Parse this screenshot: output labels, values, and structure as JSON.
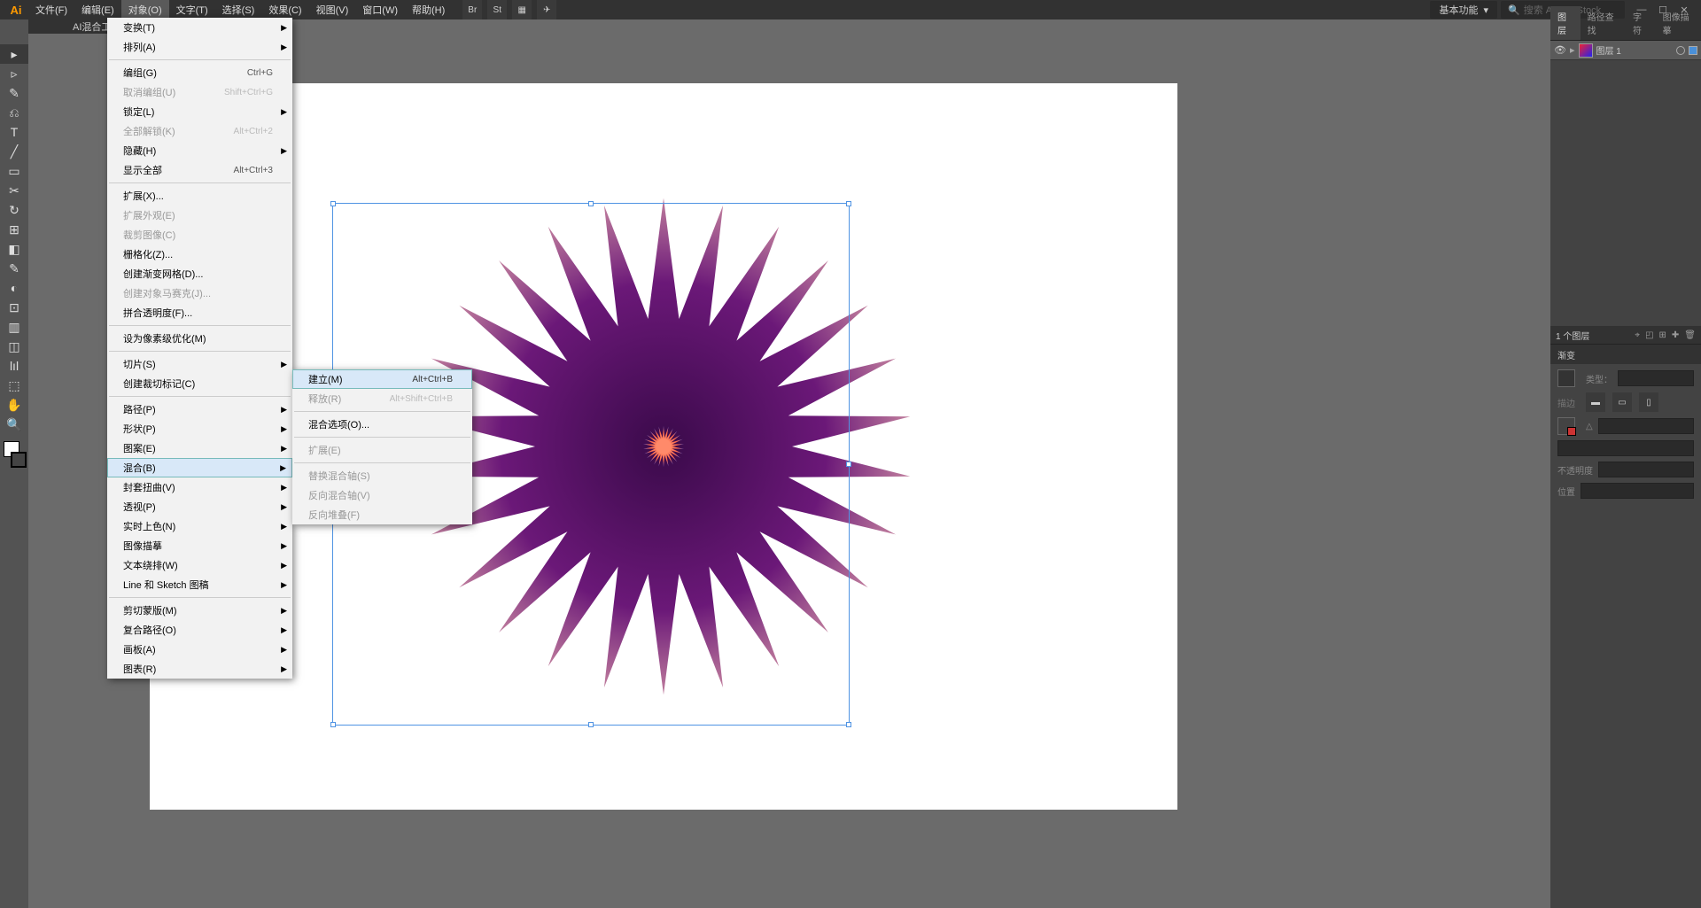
{
  "app_icon": "Ai",
  "menubar": [
    "文件(F)",
    "编辑(E)",
    "对象(O)",
    "文字(T)",
    "选择(S)",
    "效果(C)",
    "视图(V)",
    "窗口(W)",
    "帮助(H)"
  ],
  "active_menu_index": 2,
  "workspace": "基本功能",
  "search_placeholder": "搜索 Adobe Stock",
  "doc_tab": "AI混合工具.ai* @",
  "object_menu": [
    {
      "label": "变换(T)",
      "sub": true
    },
    {
      "label": "排列(A)",
      "sub": true
    },
    {
      "sep": true
    },
    {
      "label": "编组(G)",
      "shortcut": "Ctrl+G"
    },
    {
      "label": "取消编组(U)",
      "shortcut": "Shift+Ctrl+G",
      "disabled": true
    },
    {
      "label": "锁定(L)",
      "sub": true
    },
    {
      "label": "全部解锁(K)",
      "shortcut": "Alt+Ctrl+2",
      "disabled": true
    },
    {
      "label": "隐藏(H)",
      "sub": true
    },
    {
      "label": "显示全部",
      "shortcut": "Alt+Ctrl+3"
    },
    {
      "sep": true
    },
    {
      "label": "扩展(X)..."
    },
    {
      "label": "扩展外观(E)",
      "disabled": true
    },
    {
      "label": "裁剪图像(C)",
      "disabled": true
    },
    {
      "label": "栅格化(Z)..."
    },
    {
      "label": "创建渐变网格(D)..."
    },
    {
      "label": "创建对象马赛克(J)...",
      "disabled": true
    },
    {
      "label": "拼合透明度(F)..."
    },
    {
      "sep": true
    },
    {
      "label": "设为像素级优化(M)"
    },
    {
      "sep": true
    },
    {
      "label": "切片(S)",
      "sub": true
    },
    {
      "label": "创建裁切标记(C)"
    },
    {
      "sep": true
    },
    {
      "label": "路径(P)",
      "sub": true
    },
    {
      "label": "形状(P)",
      "sub": true
    },
    {
      "label": "图案(E)",
      "sub": true
    },
    {
      "label": "混合(B)",
      "sub": true,
      "hover": true
    },
    {
      "label": "封套扭曲(V)",
      "sub": true
    },
    {
      "label": "透视(P)",
      "sub": true
    },
    {
      "label": "实时上色(N)",
      "sub": true
    },
    {
      "label": "图像描摹",
      "sub": true
    },
    {
      "label": "文本绕排(W)",
      "sub": true
    },
    {
      "label": "Line 和 Sketch 图稿",
      "sub": true
    },
    {
      "sep": true
    },
    {
      "label": "剪切蒙版(M)",
      "sub": true
    },
    {
      "label": "复合路径(O)",
      "sub": true
    },
    {
      "label": "画板(A)",
      "sub": true
    },
    {
      "label": "图表(R)",
      "sub": true
    }
  ],
  "blend_submenu": [
    {
      "label": "建立(M)",
      "shortcut": "Alt+Ctrl+B",
      "hover": true
    },
    {
      "label": "释放(R)",
      "shortcut": "Alt+Shift+Ctrl+B",
      "disabled": true
    },
    {
      "sep": true
    },
    {
      "label": "混合选项(O)..."
    },
    {
      "sep": true
    },
    {
      "label": "扩展(E)",
      "disabled": true
    },
    {
      "sep": true
    },
    {
      "label": "替换混合轴(S)",
      "disabled": true
    },
    {
      "label": "反向混合轴(V)",
      "disabled": true
    },
    {
      "label": "反向堆叠(F)",
      "disabled": true
    }
  ],
  "panels": {
    "layers_tabs": [
      "图层",
      "路径查找",
      "字符",
      "图像描摹"
    ],
    "layer_name": "图层 1",
    "layer_status": "1 个图层",
    "gradient_title": "渐变",
    "gradient_type": "类型：",
    "opacity_label": "不透明度",
    "position_label": "位置"
  },
  "tools": [
    "▸",
    "▹",
    "✎",
    "⎌",
    "T",
    "╱",
    "▭",
    "✂",
    "↻",
    "⊞",
    "◧",
    "✎",
    "◐",
    "⊡",
    "▥",
    "◫",
    "lıl",
    "⬚",
    "✋",
    "🔍"
  ]
}
